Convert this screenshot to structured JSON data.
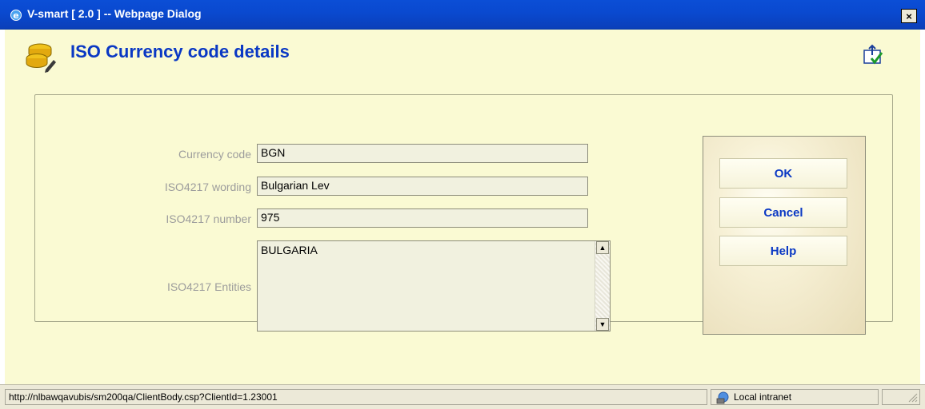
{
  "window": {
    "title": "V-smart [ 2.0 ] -- Webpage Dialog",
    "close_glyph": "×"
  },
  "header": {
    "title": "ISO Currency code details",
    "icon": "coins-edit-icon",
    "corner_icon": "toggle-view-icon"
  },
  "form": {
    "fields": [
      {
        "label": "Currency code",
        "value": "BGN"
      },
      {
        "label": "ISO4217 wording",
        "value": "Bulgarian Lev"
      },
      {
        "label": "ISO4217 number",
        "value": "975"
      }
    ],
    "entities": {
      "label": "ISO4217 Entities",
      "value": "BULGARIA"
    }
  },
  "buttons": {
    "ok": "OK",
    "cancel": "Cancel",
    "help": "Help"
  },
  "status": {
    "url": "http://nlbawqavubis/sm200qa/ClientBody.csp?ClientId=1.23001",
    "zone": "Local intranet"
  },
  "colors": {
    "title_bar": "#0a49cf",
    "client_bg": "#fafad3",
    "heading": "#0a38c4",
    "label": "#9c9c9c"
  }
}
